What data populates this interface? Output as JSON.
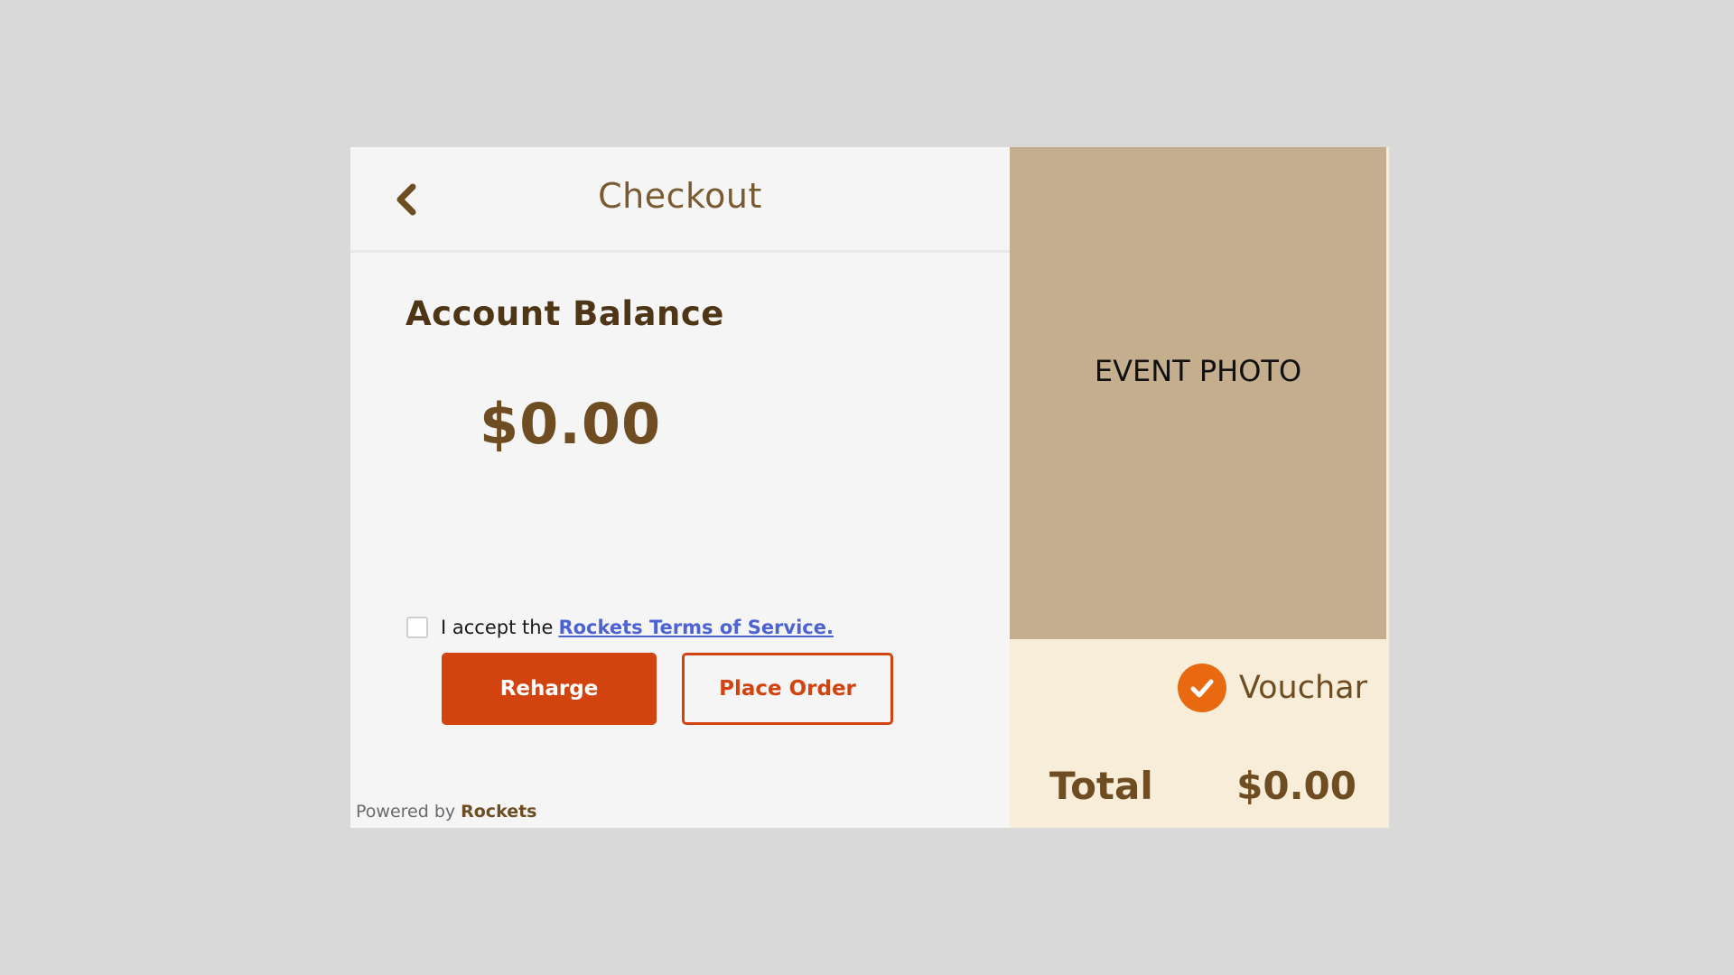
{
  "header": {
    "title": "Checkout",
    "back_icon": "chevron-left-icon"
  },
  "balance": {
    "label": "Account Balance",
    "amount": "$0.00"
  },
  "terms": {
    "prefix": "I accept the",
    "link_text": "Rockets Terms of Service.",
    "checked": false
  },
  "actions": {
    "recharge_label": "Reharge",
    "place_order_label": "Place Order"
  },
  "footer": {
    "powered_by": "Powered by",
    "brand": "Rockets"
  },
  "sidebar": {
    "photo_label": "EVENT PHOTO",
    "voucher_label": "Vouchar",
    "voucher_checked": true,
    "total_label": "Total",
    "total_amount": "$0.00"
  },
  "colors": {
    "accent": "#d2430f",
    "voucher_check": "#e8690f",
    "brown_text": "#6e4d22",
    "photo_placeholder": "#c4ae8e",
    "summary_bg": "#f7edd9",
    "link": "#4d63d1"
  }
}
